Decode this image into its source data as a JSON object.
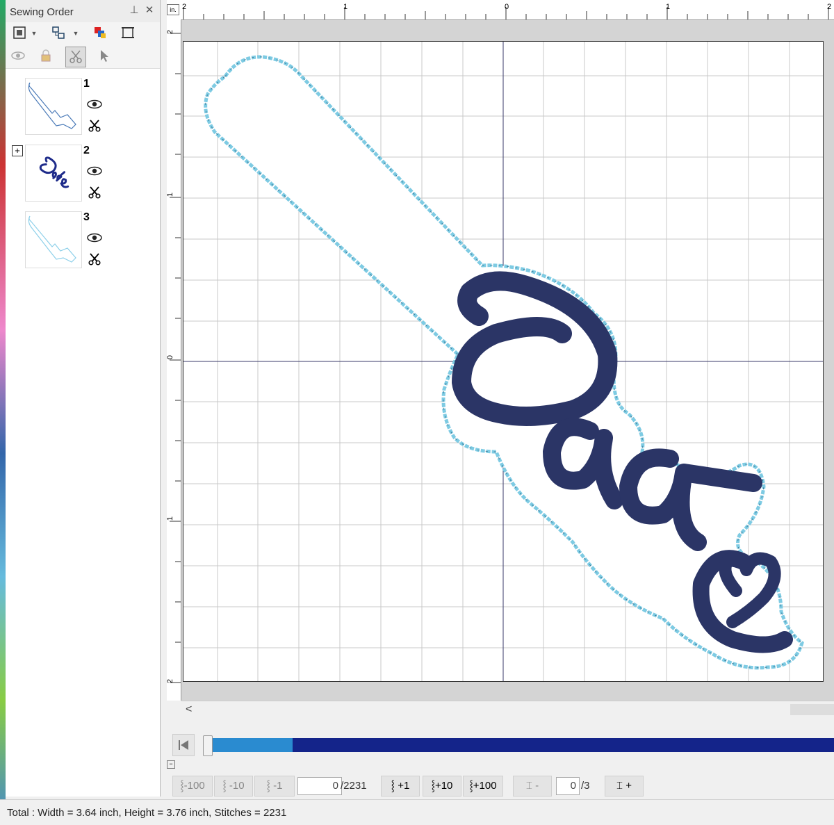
{
  "panel": {
    "title": "Sewing Order",
    "items": [
      {
        "number": "1"
      },
      {
        "number": "2",
        "expander": "+"
      },
      {
        "number": "3"
      }
    ]
  },
  "ruler": {
    "unit": "in.",
    "h_labels": [
      "2",
      "1",
      "0",
      "1",
      "2"
    ],
    "v_labels": [
      "2",
      "1",
      "0",
      "1",
      "2"
    ]
  },
  "simulator": {
    "back100": "-100",
    "back10": "-10",
    "back1": "-1",
    "stitch_current": "0",
    "stitch_total": "/2231",
    "fwd1": "+1",
    "fwd10": "+10",
    "fwd100": "+100",
    "color_minus": "-",
    "color_current": "0",
    "color_total": "/3",
    "color_plus": "+",
    "progress": 0.13
  },
  "status": {
    "text": "Total : Width = 3.64 inch, Height = 3.76 inch, Stitches = 2231"
  },
  "colors": {
    "outline": "#7ecbe3",
    "fill": "#2b3566",
    "slider_fill": "#2a8bd0",
    "slider_track": "#14248a"
  }
}
